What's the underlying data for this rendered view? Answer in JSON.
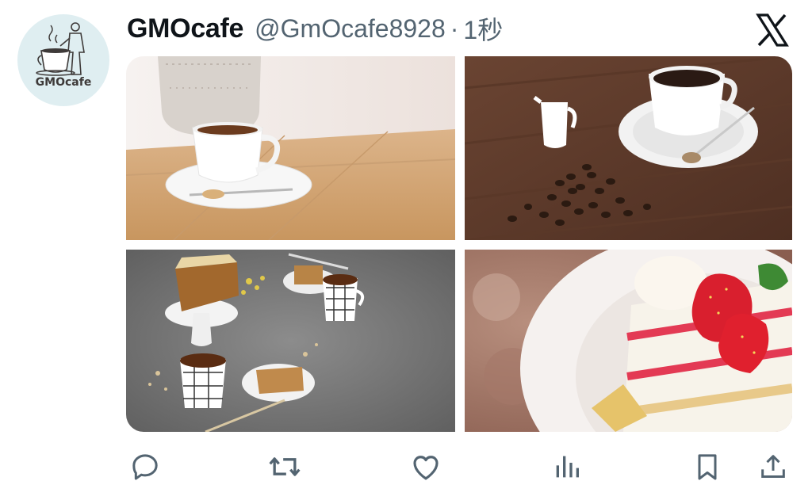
{
  "tweet": {
    "display_name": "GMOcafe",
    "handle": "@GmOcafe8928",
    "separator": "·",
    "time": "1秒",
    "avatar_text": "GMOcafe"
  },
  "media": [
    {
      "alt": "coffee cup on wooden table"
    },
    {
      "alt": "coffee cup with milk pitcher and coffee beans"
    },
    {
      "alt": "cake with tea cups on gray table"
    },
    {
      "alt": "strawberry shortcake"
    }
  ],
  "actions": [
    "reply-icon",
    "retweet-icon",
    "like-icon",
    "views-icon",
    "bookmark-icon",
    "share-icon"
  ],
  "colors": {
    "text": "#0f1419",
    "secondary": "#536471",
    "avatar_bg": "#dfeef1"
  }
}
